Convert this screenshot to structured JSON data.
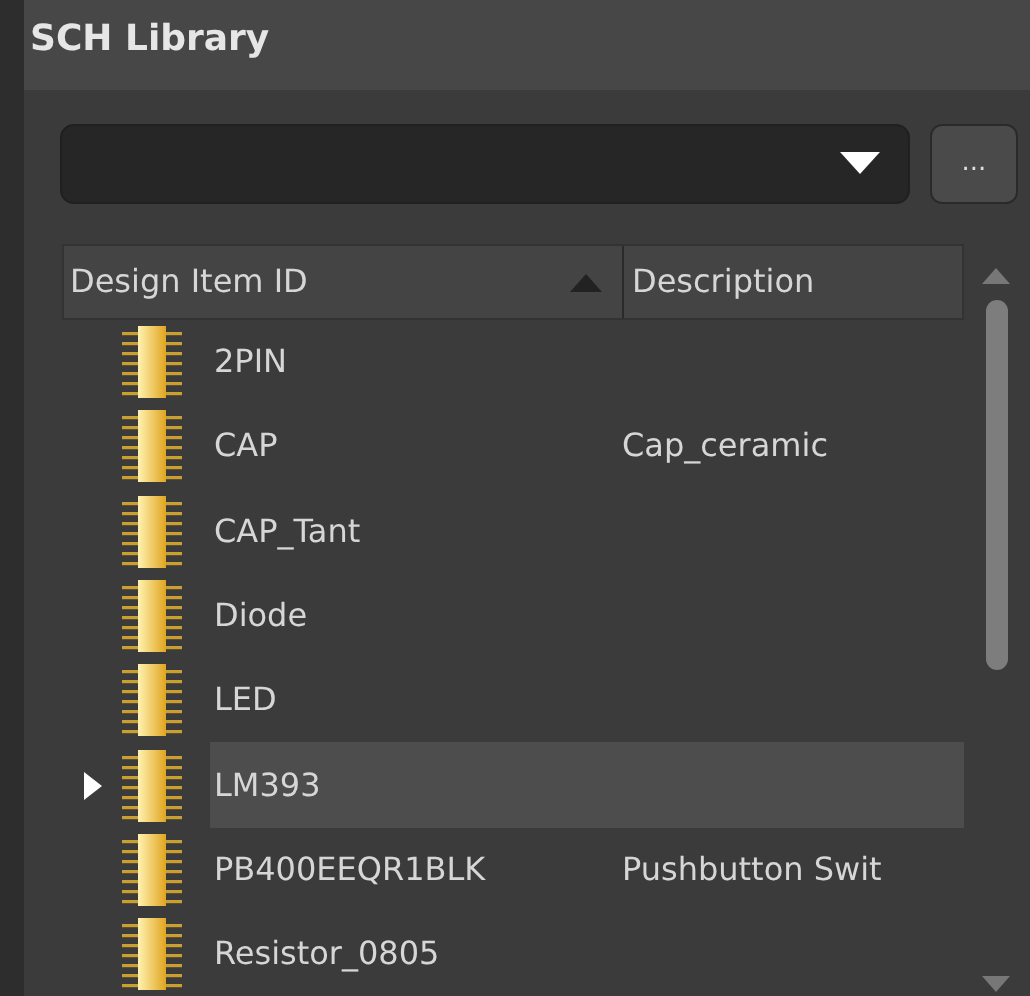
{
  "panel": {
    "title": "SCH Library"
  },
  "filter": {
    "button": "..."
  },
  "table": {
    "columns": [
      {
        "label": "Design Item ID",
        "sorted": true
      },
      {
        "label": "Description",
        "sorted": false
      }
    ],
    "rows": [
      {
        "id": "2PIN",
        "selected": false
      },
      {
        "id": "CAP",
        "description": "Cap_ceramic",
        "selected": false
      },
      {
        "id": "CAP_Tant",
        "selected": false
      },
      {
        "id": "Diode",
        "selected": false
      },
      {
        "id": "LED",
        "selected": false
      },
      {
        "id": "LM393",
        "selected": true
      },
      {
        "id": "PB400EEQR1BLK",
        "description": "Pushbutton Swit",
        "selected": false
      },
      {
        "id": "Resistor_0805",
        "selected": false
      }
    ]
  }
}
